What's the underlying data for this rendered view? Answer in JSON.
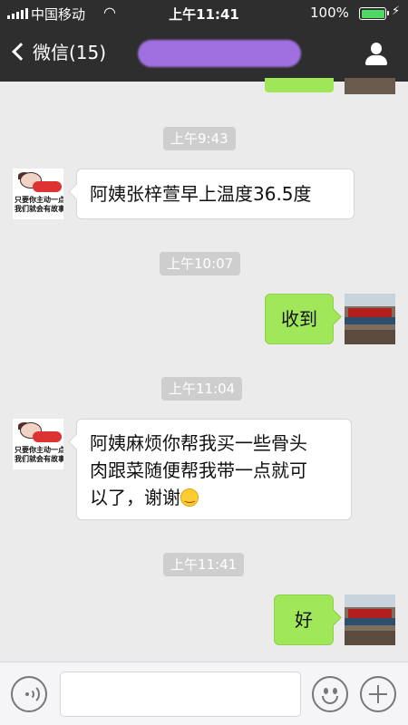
{
  "status_bar": {
    "carrier": "中国移动",
    "time": "上午11:41",
    "battery": "100%"
  },
  "header": {
    "back_label": "微信(15)"
  },
  "messages": [
    {
      "type": "time",
      "text": "上午9:43"
    },
    {
      "type": "received",
      "text": "阿姨张梓萱早上温度36.5度",
      "avatar_caption": [
        "只要你主动一点",
        "我们就会有故事"
      ]
    },
    {
      "type": "time",
      "text": "上午10:07"
    },
    {
      "type": "sent",
      "text": "收到"
    },
    {
      "type": "time",
      "text": "上午11:04"
    },
    {
      "type": "received",
      "text_lines": [
        "阿姨麻烦你帮我买一些骨头",
        "肉跟菜随便帮我带一点就可",
        "以了，谢谢"
      ],
      "emoji": "smile-emoji",
      "avatar_caption": [
        "只要你主动一点",
        "我们就会有故事"
      ]
    },
    {
      "type": "time",
      "text": "上午11:41"
    },
    {
      "type": "sent",
      "text": "好"
    }
  ],
  "colors": {
    "header_bg": "#2e2e2e",
    "chat_bg": "#ebebeb",
    "sent_bubble": "#a0e75a",
    "received_bubble": "#ffffff",
    "timestamp_bg": "#cecece"
  },
  "input_bar": {
    "text_value": "",
    "icons": [
      "voice-icon",
      "emoji-icon",
      "plus-icon"
    ]
  }
}
